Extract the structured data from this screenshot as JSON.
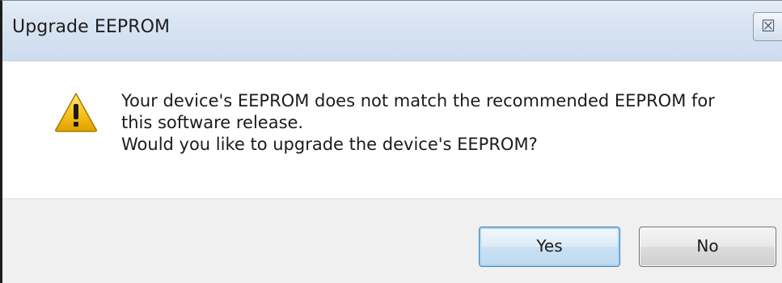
{
  "dialog": {
    "title": "Upgrade EEPROM",
    "close_glyph": "☒",
    "icon": "warning-triangle-icon",
    "message_lines": [
      "Your device's EEPROM does not match the recommended EEPROM for",
      "this software release.",
      "Would you like to upgrade the device's EEPROM?"
    ],
    "buttons": {
      "yes_label": "Yes",
      "no_label": "No"
    },
    "colors": {
      "title_bar": "#d8e4f2",
      "footer": "#f0f0f0",
      "warning_fill": "#f7c51e",
      "default_button_border": "#3c7fb1"
    }
  }
}
